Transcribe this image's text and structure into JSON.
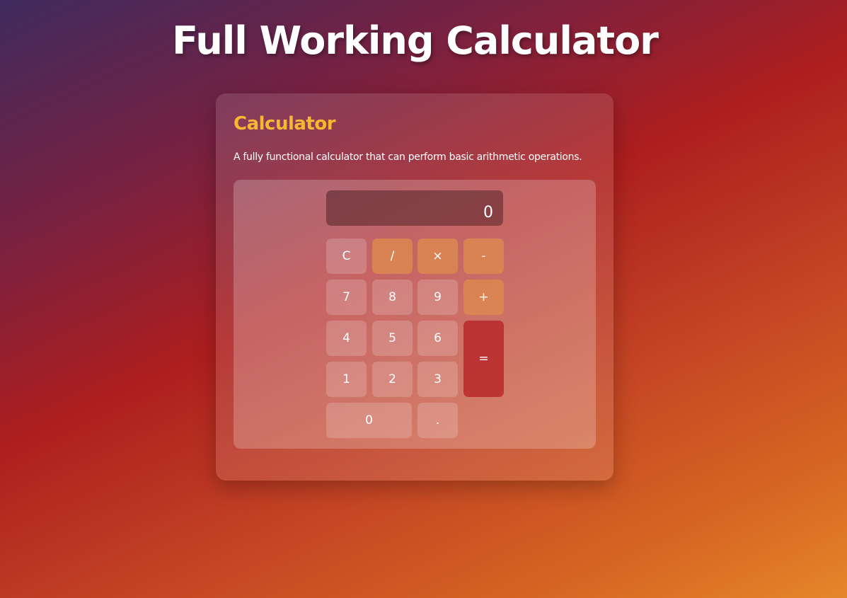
{
  "page": {
    "title": "Full Working Calculator"
  },
  "card": {
    "title": "Calculator",
    "description": "A fully functional calculator that can perform basic arithmetic operations."
  },
  "calculator": {
    "display_value": "0",
    "buttons": {
      "clear": "C",
      "divide": "/",
      "multiply": "×",
      "subtract": "-",
      "seven": "7",
      "eight": "8",
      "nine": "9",
      "add": "+",
      "four": "4",
      "five": "5",
      "six": "6",
      "equals": "=",
      "one": "1",
      "two": "2",
      "three": "3",
      "zero": "0",
      "decimal": "."
    }
  },
  "colors": {
    "card_title": "#f7b733",
    "operator_button": "#dc8750",
    "equals_button": "#b92d2d"
  }
}
